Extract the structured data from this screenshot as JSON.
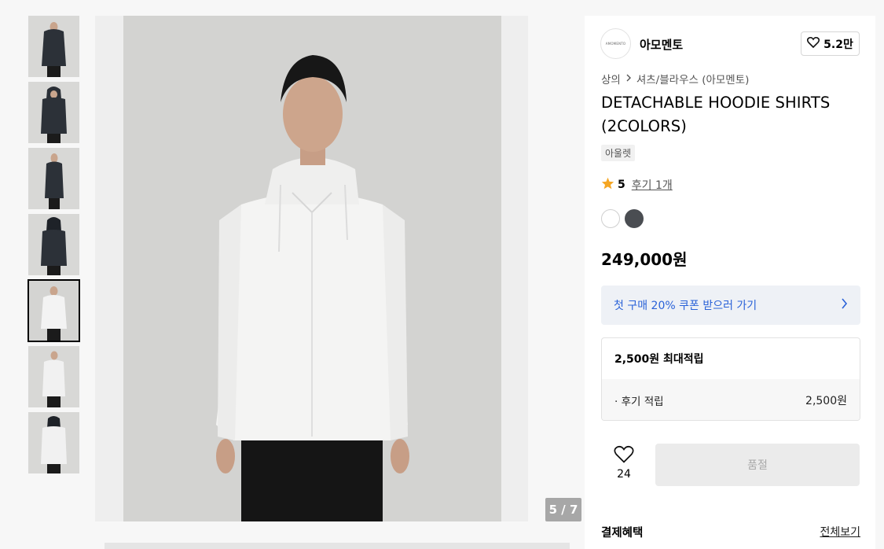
{
  "gallery": {
    "thumbnails": [
      {
        "label": "black-front"
      },
      {
        "label": "black-hood"
      },
      {
        "label": "black-side"
      },
      {
        "label": "black-back"
      },
      {
        "label": "white-front",
        "active": true
      },
      {
        "label": "white-front-2"
      },
      {
        "label": "white-back"
      }
    ],
    "counter": "5 / 7"
  },
  "brand": {
    "logo_text": "AMOMENTO",
    "name": "아모멘토",
    "like_count": "5.2만"
  },
  "breadcrumb": {
    "category": "상의",
    "subcategory": "셔츠/블라우스 (아모멘토)"
  },
  "product": {
    "title": "DETACHABLE HOODIE SHIRTS (2COLORS)",
    "tag": "아울렛",
    "rating": "5",
    "reviews": "후기 1개",
    "colors": [
      "#ffffff",
      "#4a4d52"
    ],
    "price": "249,000원"
  },
  "coupon": {
    "label": "첫 구매 20% 쿠폰 받으러 가기"
  },
  "points": {
    "max": "2,500원 최대적립",
    "review_label": "· 후기 적립",
    "review_value": "2,500원"
  },
  "purchase": {
    "wish_count": "24",
    "button": "품절"
  },
  "benefits": {
    "heading": "결제혜택",
    "see_all": "전체보기"
  },
  "colors": {
    "accent": "#2a62d8",
    "star": "#f5a623"
  }
}
